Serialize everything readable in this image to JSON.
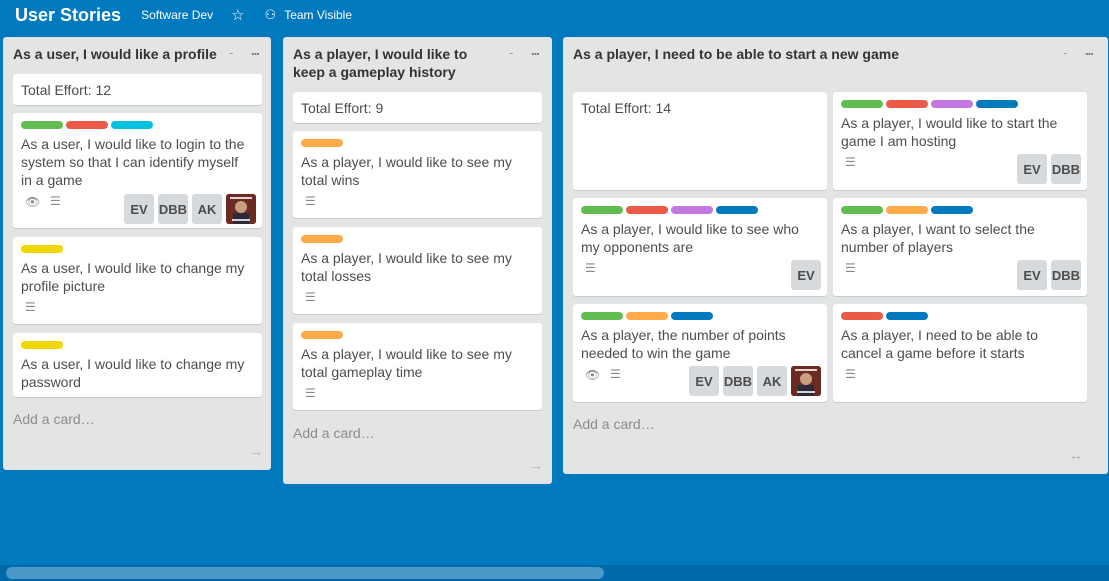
{
  "header": {
    "board_title": "User Stories",
    "organization": "Software Dev",
    "visibility": "Team Visible",
    "star_icon": "star-icon",
    "visibility_icon": "team-visibility-icon"
  },
  "colors": {
    "background": "#0079bf",
    "list": "#e2e4e6",
    "green": "#61bd4f",
    "red": "#eb5a46",
    "cyan": "#00c2e0",
    "yellow": "#f2d600",
    "orange": "#ffab4a",
    "purple": "#c377e0",
    "blue": "#0079bf"
  },
  "lists": [
    {
      "title": "As a user, I would like a profile",
      "collapse": "-",
      "menu": "...",
      "add_card": "Add a card…",
      "arrow": "→",
      "effort": "Total Effort: 12",
      "cards": [
        {
          "text_line1": "As a user, I would like to login to the",
          "text_line2": "system so that I can identify myself",
          "text_line3": "in a game",
          "members": [
            "EV",
            "DBB",
            "AK"
          ]
        },
        {
          "text_line1": "As a user, I would like to change my",
          "text_line2": "profile picture"
        },
        {
          "text_line1": "As a user, I would like to change my",
          "text_line2": "password"
        }
      ]
    },
    {
      "title_line1": "As a player, I would like to",
      "title_line2": "keep a gameplay history",
      "collapse": "-",
      "menu": "...",
      "add_card": "Add a card…",
      "arrow": "→",
      "effort": "Total Effort: 9",
      "cards": [
        {
          "text_line1": "As a player, I would like to see my",
          "text_line2": "total wins"
        },
        {
          "text_line1": "As a player, I would like to see my",
          "text_line2": "total losses"
        },
        {
          "text_line1": "As a player, I would like to see my",
          "text_line2": "total gameplay time"
        }
      ]
    },
    {
      "title": "As a player, I need to be able to start a new game",
      "collapse": "-",
      "menu": "...",
      "add_card": "Add a card…",
      "arrow": "↔",
      "effort": "Total Effort: 14",
      "cards": [
        {
          "text_line1": "As a player, I would like to start the",
          "text_line2": "game I am hosting",
          "members": [
            "EV",
            "DBB"
          ]
        },
        {
          "text_line1": "As a player, I would like to see who",
          "text_line2": "my opponents are",
          "members": [
            "EV"
          ]
        },
        {
          "text_line1": "As a player, I want to select the",
          "text_line2": "number of players",
          "members": [
            "EV",
            "DBB"
          ]
        },
        {
          "text_line1": "As a player, the number of points",
          "text_line2": "needed to win the game",
          "members": [
            "EV",
            "DBB",
            "AK"
          ]
        },
        {
          "text_line1": "As a player, I need to be able to",
          "text_line2": "cancel a game before it starts"
        }
      ]
    }
  ]
}
